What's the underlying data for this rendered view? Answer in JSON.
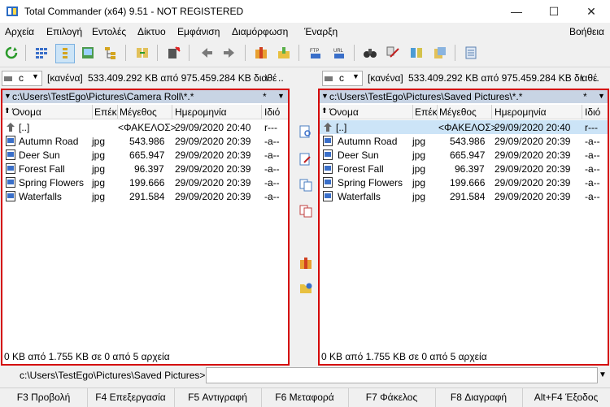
{
  "window": {
    "title": "Total Commander (x64) 9.51 - NOT REGISTERED",
    "minimize": "—",
    "maximize": "☐",
    "close": "✕"
  },
  "menu": {
    "items": [
      "Αρχεία",
      "Επιλογή",
      "Εντολές",
      "Δίκτυο",
      "Εμφάνιση",
      "Διαμόρφωση",
      "Έναρξη"
    ],
    "help": "Βοήθεια"
  },
  "drives": {
    "left": {
      "letter": "c",
      "label": "[κανένα]",
      "space": "533.409.292 KB από 975.459.284 KB διαθέ",
      "root": "\\",
      "up": ".."
    },
    "right": {
      "letter": "c",
      "label": "[κανένα]",
      "space": "533.409.292 KB από 975.459.284 KB διαθέ",
      "root": "\\",
      "up": ".."
    }
  },
  "columns": {
    "name": "Όνομα",
    "ext": "Επέκ",
    "size": "Μέγεθος",
    "date": "Ημερομηνία",
    "attr": "Ιδιό"
  },
  "left_panel": {
    "path": "c:\\Users\\TestEgo\\Pictures\\Camera Roll\\*.*",
    "star": "*",
    "status": "0 KB από 1.755 KB σε 0 από 5 αρχεία",
    "rows": [
      {
        "name": "[..]",
        "ext": "",
        "size": "<ΦΑΚΕΛΟΣ>",
        "date": "29/09/2020 20:40",
        "attr": "r---"
      },
      {
        "name": "Autumn Road",
        "ext": "jpg",
        "size": "543.986",
        "date": "29/09/2020 20:39",
        "attr": "-a--"
      },
      {
        "name": "Deer Sun",
        "ext": "jpg",
        "size": "665.947",
        "date": "29/09/2020 20:39",
        "attr": "-a--"
      },
      {
        "name": "Forest Fall",
        "ext": "jpg",
        "size": "96.397",
        "date": "29/09/2020 20:39",
        "attr": "-a--"
      },
      {
        "name": "Spring Flowers",
        "ext": "jpg",
        "size": "199.666",
        "date": "29/09/2020 20:39",
        "attr": "-a--"
      },
      {
        "name": "Waterfalls",
        "ext": "jpg",
        "size": "291.584",
        "date": "29/09/2020 20:39",
        "attr": "-a--"
      }
    ]
  },
  "right_panel": {
    "path": "c:\\Users\\TestEgo\\Pictures\\Saved Pictures\\*.*",
    "star": "*",
    "status": "0 KB από 1.755 KB σε 0 από 5 αρχεία",
    "rows": [
      {
        "name": "[..]",
        "ext": "",
        "size": "<ΦΑΚΕΛΟΣ>",
        "date": "29/09/2020 20:40",
        "attr": "r---"
      },
      {
        "name": "Autumn Road",
        "ext": "jpg",
        "size": "543.986",
        "date": "29/09/2020 20:39",
        "attr": "-a--"
      },
      {
        "name": "Deer Sun",
        "ext": "jpg",
        "size": "665.947",
        "date": "29/09/2020 20:39",
        "attr": "-a--"
      },
      {
        "name": "Forest Fall",
        "ext": "jpg",
        "size": "96.397",
        "date": "29/09/2020 20:39",
        "attr": "-a--"
      },
      {
        "name": "Spring Flowers",
        "ext": "jpg",
        "size": "199.666",
        "date": "29/09/2020 20:39",
        "attr": "-a--"
      },
      {
        "name": "Waterfalls",
        "ext": "jpg",
        "size": "291.584",
        "date": "29/09/2020 20:39",
        "attr": "-a--"
      }
    ]
  },
  "cmdline": {
    "prompt": "c:\\Users\\TestEgo\\Pictures\\Saved Pictures>",
    "value": ""
  },
  "fkeys": [
    "F3 Προβολή",
    "F4 Επεξεργασία",
    "F5 Αντιγραφή",
    "F6 Μεταφορά",
    "F7 Φάκελος",
    "F8 Διαγραφή",
    "Alt+F4 Έξοδος"
  ],
  "colors": {
    "highlight": "#cce4f7",
    "pathbar": "#c8d4e4",
    "panel_border": "#d40000"
  }
}
